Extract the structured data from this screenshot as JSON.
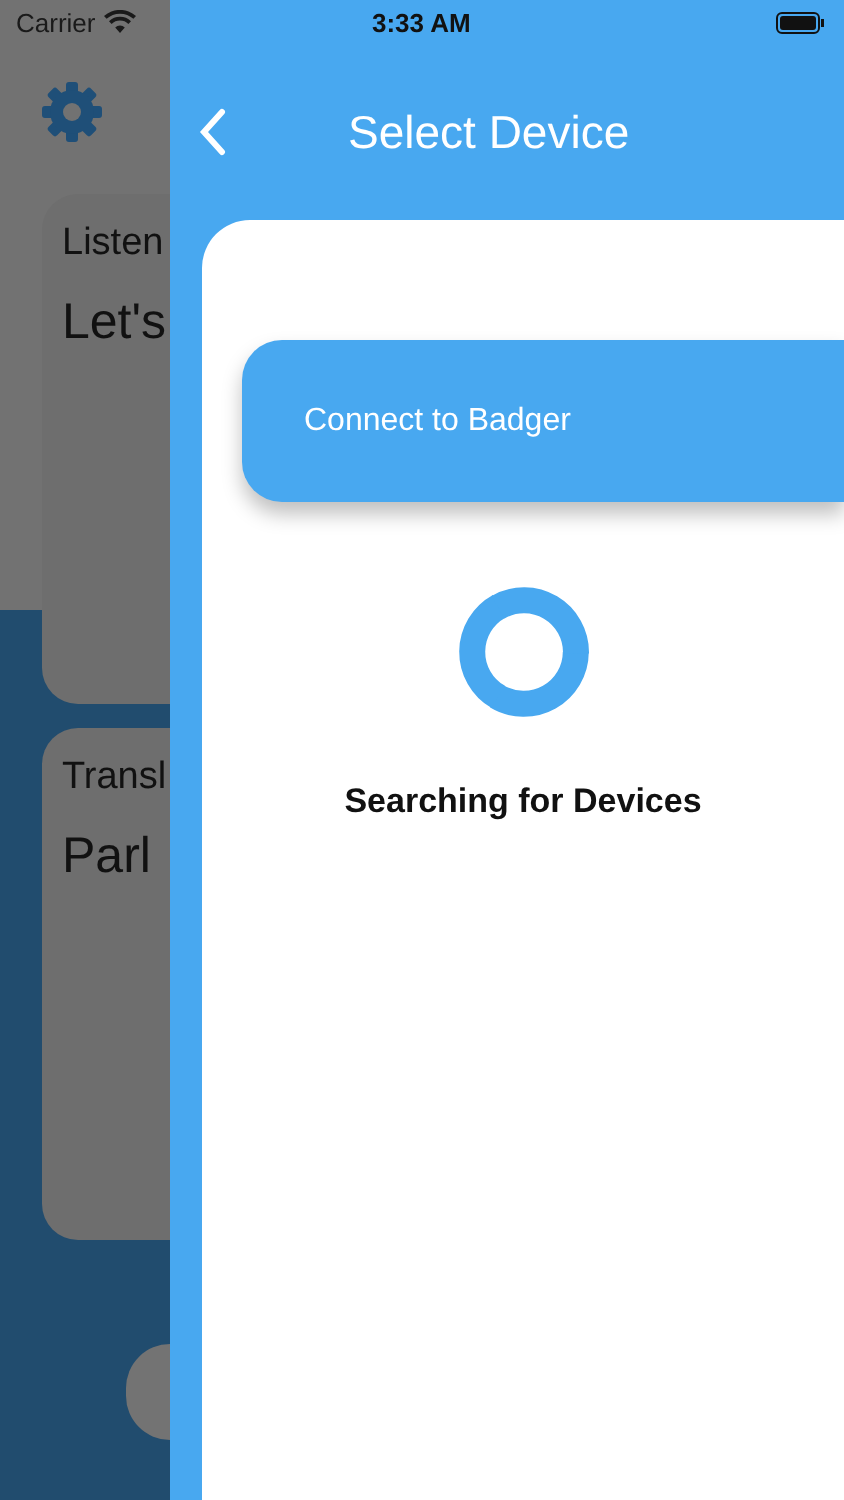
{
  "status_bar": {
    "carrier": "Carrier",
    "time": "3:33 AM"
  },
  "background": {
    "cards": [
      {
        "title": "Listen",
        "text": "Let's"
      },
      {
        "title": "Transl",
        "text": "Parl"
      }
    ]
  },
  "drawer": {
    "title": "Select Device",
    "devices": [
      {
        "label": "Connect to Badger"
      }
    ],
    "status": "Searching for Devices"
  }
}
